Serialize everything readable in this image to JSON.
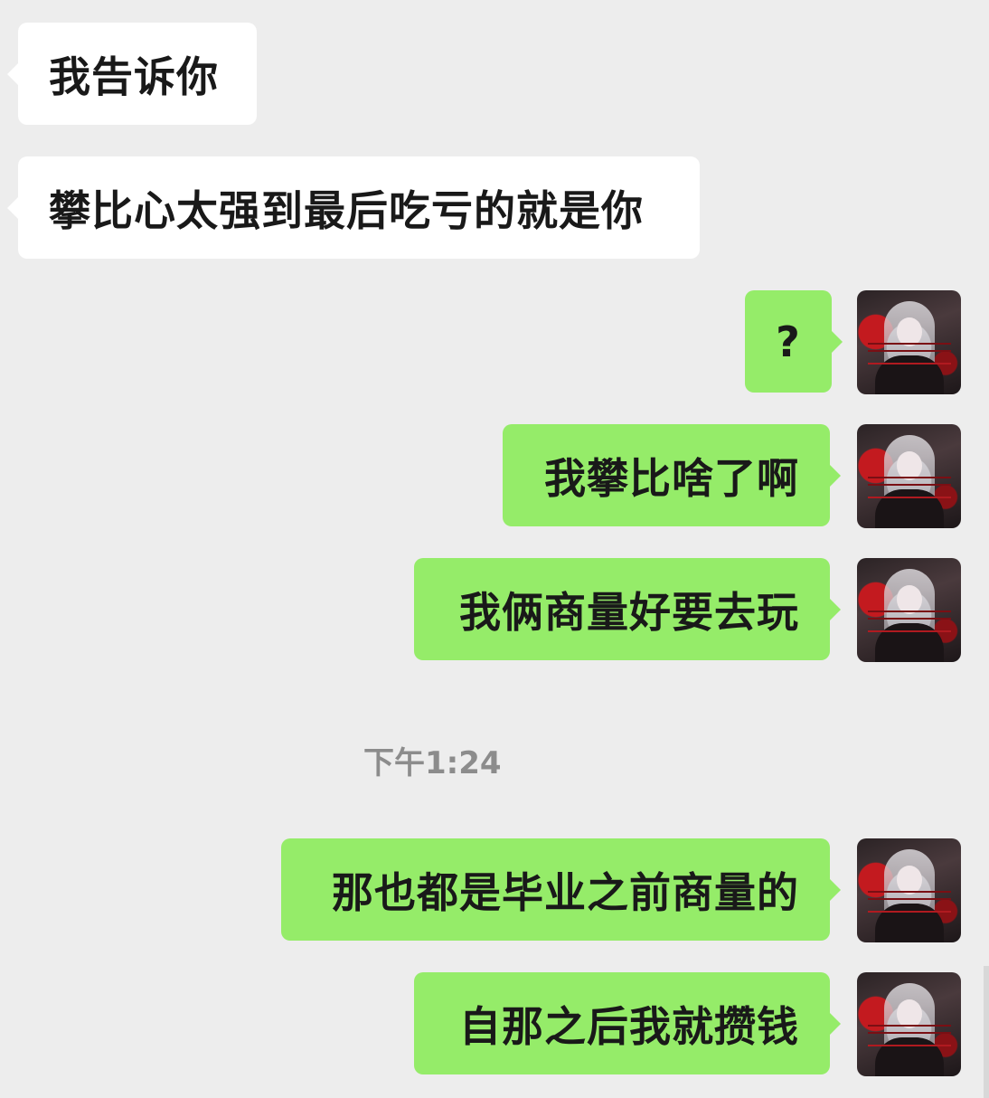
{
  "chat": {
    "messages": [
      {
        "side": "in",
        "text": "我告诉你"
      },
      {
        "side": "in",
        "text": "攀比心太强到最后吃亏的就是你"
      },
      {
        "side": "out",
        "text": "?"
      },
      {
        "side": "out",
        "text": "我攀比啥了啊"
      },
      {
        "side": "out",
        "text": "我俩商量好要去玩"
      },
      {
        "side": "out",
        "text": "那也都是毕业之前商量的"
      },
      {
        "side": "out",
        "text": "自那之后我就攒钱"
      }
    ],
    "timestamp": "下午1:24"
  },
  "colors": {
    "background": "#ededed",
    "incoming_bubble": "#ffffff",
    "outgoing_bubble": "#95ec69",
    "timestamp": "#8c8c8c"
  },
  "icons": {
    "avatar": "user-avatar-anime-girl"
  }
}
